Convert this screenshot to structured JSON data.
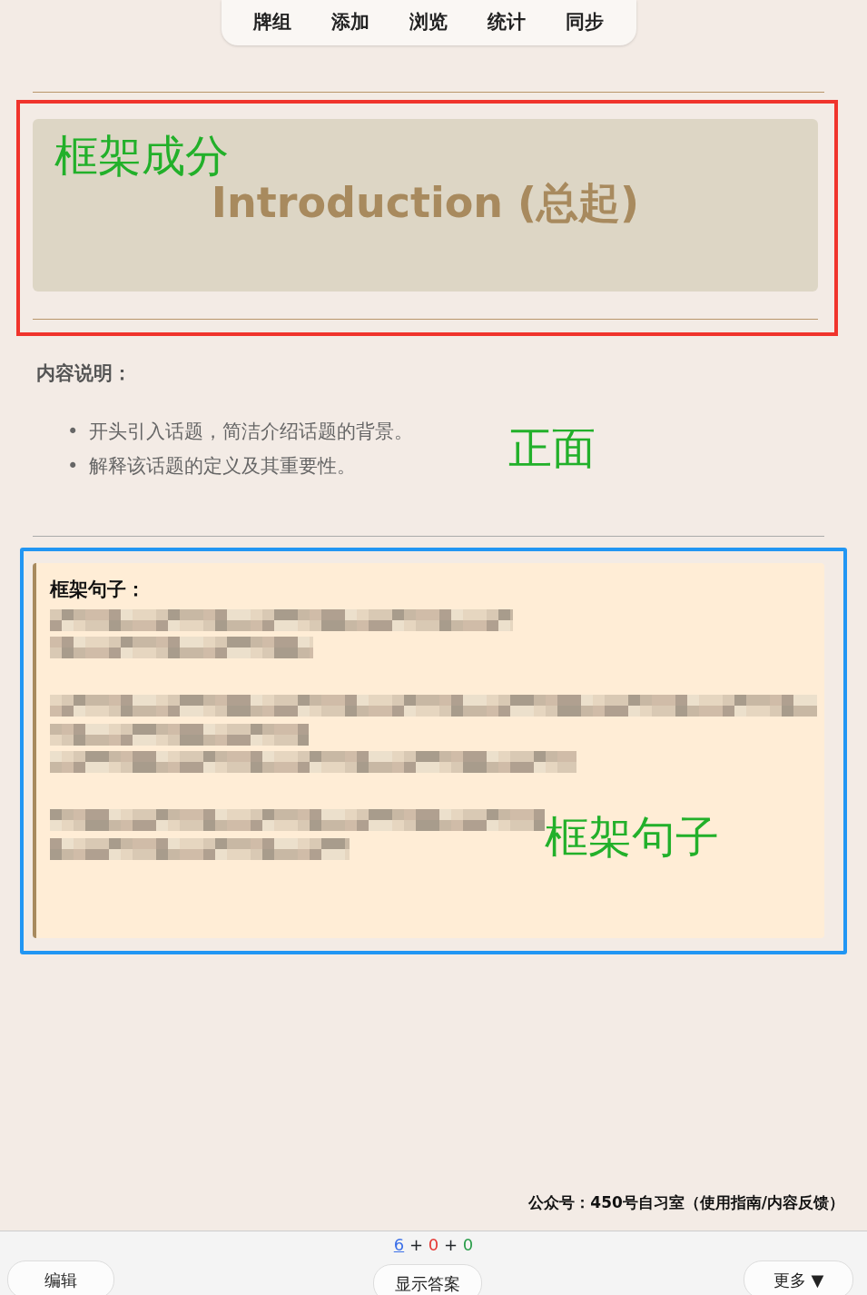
{
  "top_menu": [
    {
      "label": "牌组"
    },
    {
      "label": "添加"
    },
    {
      "label": "浏览"
    },
    {
      "label": "统计"
    },
    {
      "label": "同步"
    }
  ],
  "header_section": {
    "annotation": "框架成分",
    "title": "Introduction (总起)"
  },
  "description": {
    "heading": "内容说明：",
    "items": [
      {
        "bullet": "•",
        "text": "开头引入话题，简洁介绍话题的背景。"
      },
      {
        "bullet": "•",
        "text": "解释该话题的定义及其重要性。"
      }
    ],
    "annotation": "正面"
  },
  "sentence_card": {
    "heading": "框架句子：",
    "annotation": "框架句子"
  },
  "footer_note": "公众号：450号自习室（使用指南/内容反馈）",
  "counts": [
    {
      "value": "6",
      "kind": "new"
    },
    {
      "value": "0",
      "kind": "learn"
    },
    {
      "value": "0",
      "kind": "review"
    }
  ],
  "separators": [
    "+",
    "+"
  ],
  "bottom_buttons": [
    {
      "label": "编辑",
      "kind": "edit"
    },
    {
      "label": "显示答案",
      "kind": "answer"
    },
    {
      "label": "更多 ▼",
      "kind": "more"
    }
  ]
}
